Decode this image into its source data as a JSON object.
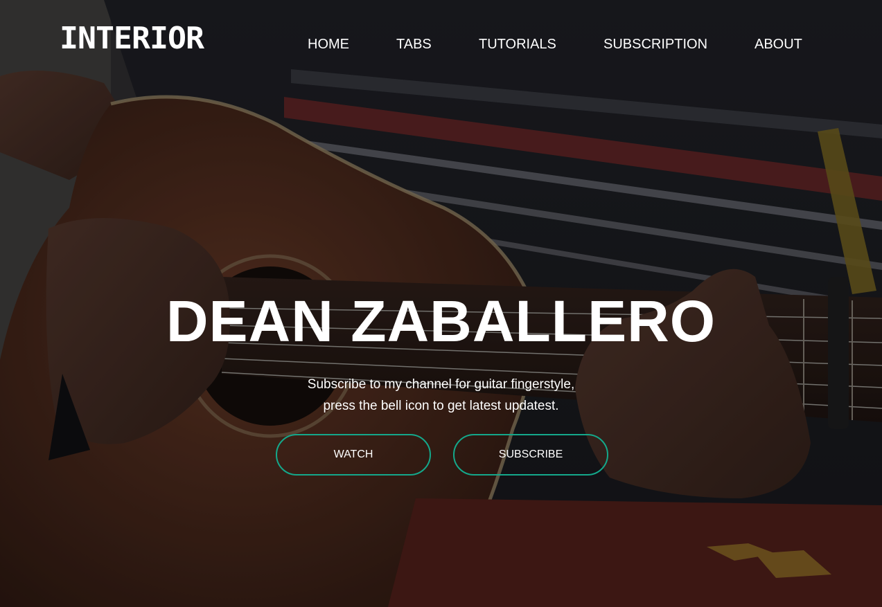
{
  "brand": {
    "logo_text": "INTERIOR"
  },
  "nav": {
    "items": [
      {
        "label": "HOME"
      },
      {
        "label": "TABS"
      },
      {
        "label": "TUTORIALS"
      },
      {
        "label": "SUBSCRIPTION"
      },
      {
        "label": "ABOUT"
      }
    ]
  },
  "hero": {
    "title": "DEAN ZABALLERO",
    "tagline_line1": "Subscribe to my channel for guitar fingerstyle,",
    "tagline_line2": "press the bell icon to get latest updatest.",
    "watch_label": "WATCH",
    "subscribe_label": "SUBSCRIBE",
    "background_image": "guitar-player-photo"
  },
  "colors": {
    "accent": "#14a88b",
    "text": "#ffffff"
  }
}
